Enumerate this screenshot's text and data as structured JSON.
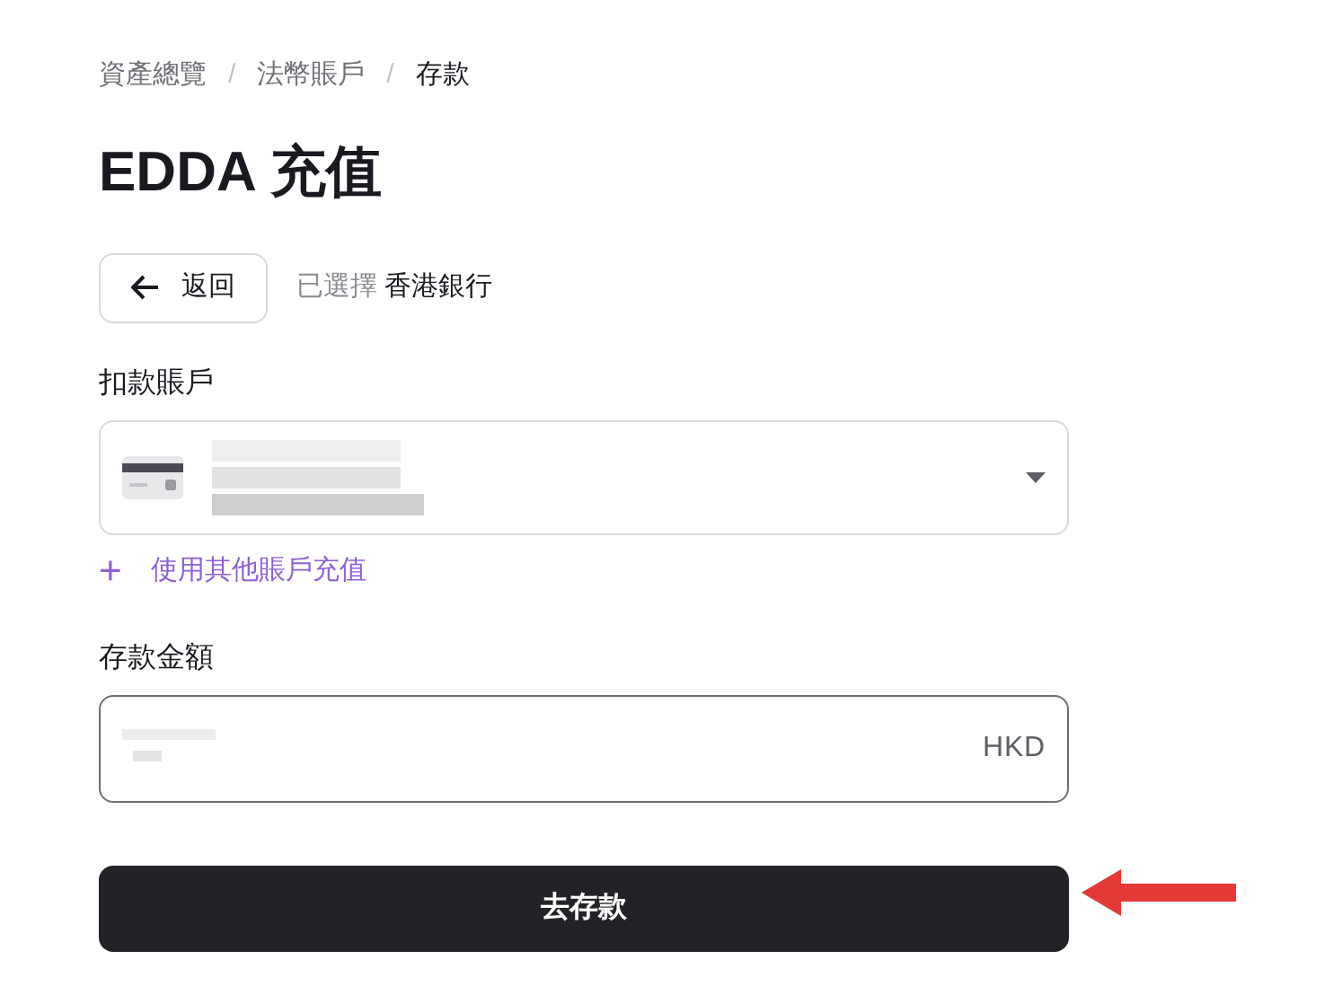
{
  "breadcrumb": {
    "separator": "/",
    "items": [
      {
        "label": "資產總覽",
        "selected": false
      },
      {
        "label": "法幣賬戶",
        "selected": false
      },
      {
        "label": "存款",
        "selected": true
      }
    ]
  },
  "title": "EDDA 充值",
  "back_button": {
    "label": "返回"
  },
  "selection": {
    "prefix": "已選擇",
    "value": "香港銀行"
  },
  "debit_account": {
    "label": "扣款賬戶",
    "redacted": true
  },
  "add_account_link": {
    "icon": "+",
    "label": "使用其他賬戶充值"
  },
  "amount": {
    "label": "存款金額",
    "redacted": true,
    "currency": "HKD"
  },
  "submit_button": {
    "label": "去存款"
  },
  "annotation_arrow": true
}
